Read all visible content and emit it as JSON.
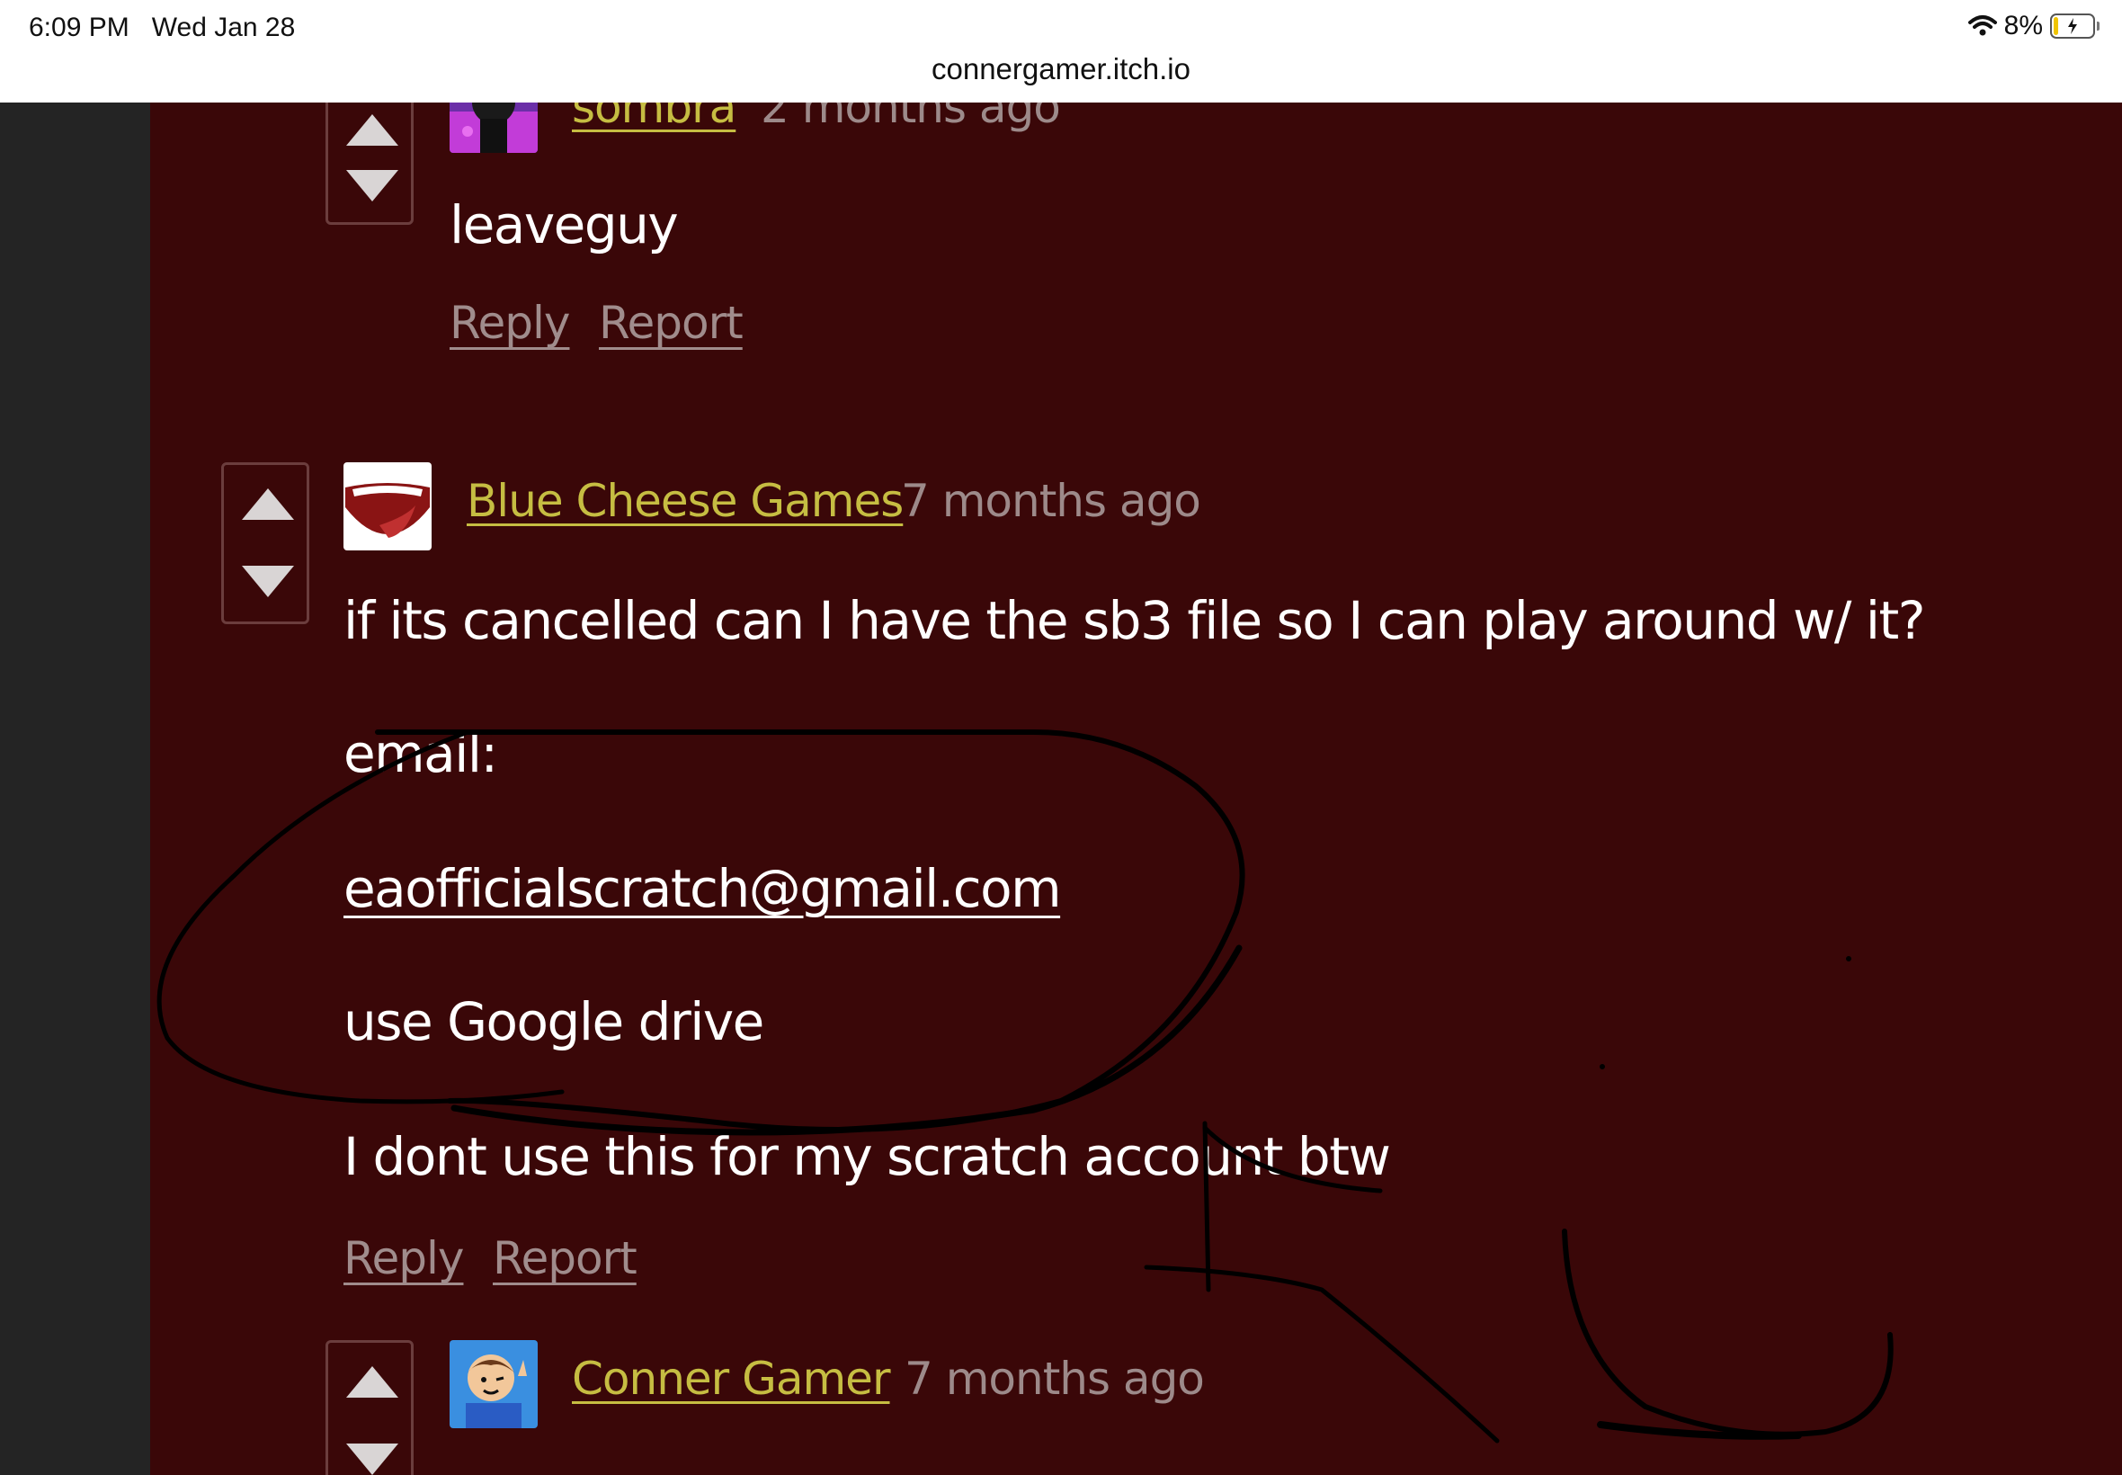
{
  "status_bar": {
    "time": "6:09 PM",
    "date": "Wed Jan 28",
    "battery": "8%",
    "url": "connergamer.itch.io"
  },
  "comments": [
    {
      "author": "sombra",
      "time": "2 months ago",
      "lines": [
        "leaveguy"
      ],
      "reply": "Reply",
      "report": "Report"
    },
    {
      "author": "Blue Cheese Games",
      "time": "7 months ago",
      "line1": "if its cancelled can I have the sb3 file so I can play around w/ it?",
      "line2": "email:",
      "email": "eaofficialscratch@gmail.com",
      "line4": "use Google drive",
      "line5": "I dont use this for my scratch account btw",
      "reply": "Reply",
      "report": "Report"
    },
    {
      "author": "Conner Gamer",
      "time": "7 months ago"
    }
  ],
  "colors": {
    "page_bg": "#3a0708",
    "author": "#c6bd42",
    "meta": "#9d8a8a"
  }
}
